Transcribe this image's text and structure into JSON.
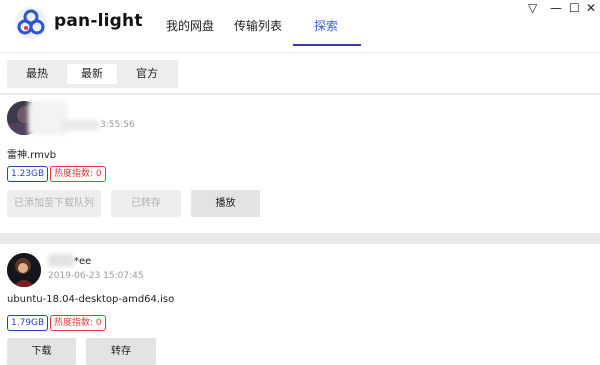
{
  "app": {
    "title": "pan-light"
  },
  "nav": {
    "tabs": [
      "我的网盘",
      "传输列表",
      "探索"
    ],
    "active_index": 2
  },
  "window_controls": {
    "menu": "▽",
    "minimize": "—",
    "maximize": "☐",
    "close": "✕"
  },
  "subtabs": {
    "items": [
      "最热",
      "最新",
      "官方"
    ],
    "active_index": 1
  },
  "posts": [
    {
      "time": "3:55:56",
      "filename": "雷神.rmvb",
      "size": "1.23GB",
      "heat": "热度指数: 0",
      "buttons": [
        "已添加至下载队列",
        "已转存",
        "播放"
      ]
    },
    {
      "username_suffix": "*ee",
      "time": "2019-06-23 15:07:45",
      "filename": "ubuntu-18.04-desktop-amd64.iso",
      "size": "1.79GB",
      "heat": "热度指数: 0",
      "buttons": [
        "下载",
        "转存"
      ]
    }
  ],
  "colors": {
    "accent": "#3b5fd9",
    "size_badge": "#2b3fc4",
    "heat_badge": "#e23b3b",
    "nav_underline": "#3b3b9a"
  },
  "icons": {
    "logo": "baidu-pan-logo-icon"
  }
}
